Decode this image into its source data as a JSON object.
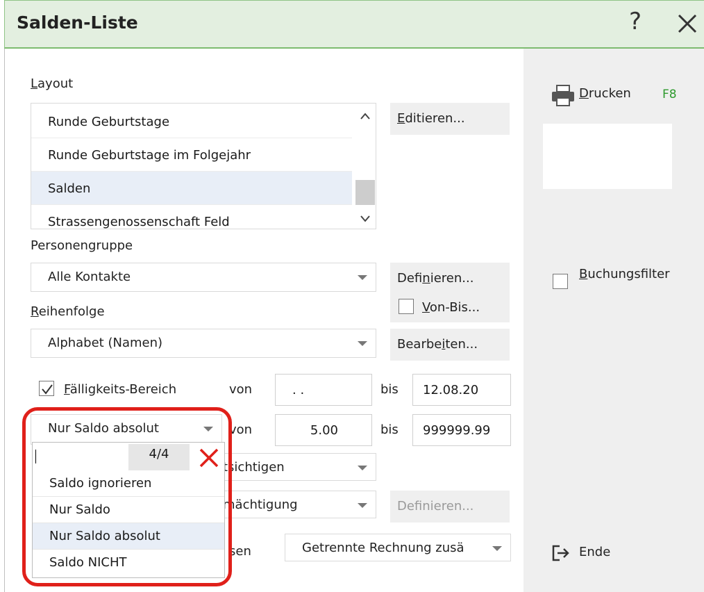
{
  "window": {
    "title": "Salden-Liste",
    "help_glyph": "?"
  },
  "layout": {
    "label": "Layout",
    "items": [
      "Runde Geburtstage",
      "Runde Geburtstage im Folgejahr",
      "Salden",
      "Strassengenossenschaft Feld"
    ],
    "selected_index": 2,
    "edit_button": "Editieren..."
  },
  "personengruppe": {
    "label": "Personengruppe",
    "value": "Alle Kontakte",
    "define_button": "Definieren...",
    "vonbis_label": "Von-Bis..."
  },
  "reihenfolge": {
    "label": "Reihenfolge",
    "value": "Alphabet (Namen)",
    "edit_button": "Bearbeiten..."
  },
  "faelligkeit": {
    "label": "Fälligkeits-Bereich",
    "checked": true,
    "von_label": "von",
    "von_value": ". .",
    "bis_label": "bis",
    "bis_value": "12.08.20"
  },
  "saldo": {
    "value": "Nur Saldo absolut",
    "von_label": "von",
    "von_value": "5.00",
    "bis_label": "bis",
    "bis_value": "999999.99",
    "dropdown": {
      "search_value": "",
      "count": "4/4",
      "options": [
        "Saldo ignorieren",
        "Nur Saldo",
        "Nur Saldo absolut",
        "Saldo NICHT"
      ],
      "highlighted_index": 2
    }
  },
  "row_berueck": {
    "partial_text": "tsichtigen"
  },
  "row_ermaecht": {
    "partial_text": "mächtigung",
    "define_button": "Definieren..."
  },
  "row_rechnung": {
    "partial_label": "sen",
    "value": "Getrennte Rechnung zusä"
  },
  "sidebar": {
    "print_label": "Drucken",
    "print_shortcut": "F8",
    "buchungsfilter_label": "Buchungsfilter",
    "end_label": "Ende"
  },
  "colors": {
    "title_bg": "#e3efe0",
    "accent_green": "#2d9a2d",
    "highlight_red": "#e0201a",
    "selection_bg": "#e8eef7"
  }
}
